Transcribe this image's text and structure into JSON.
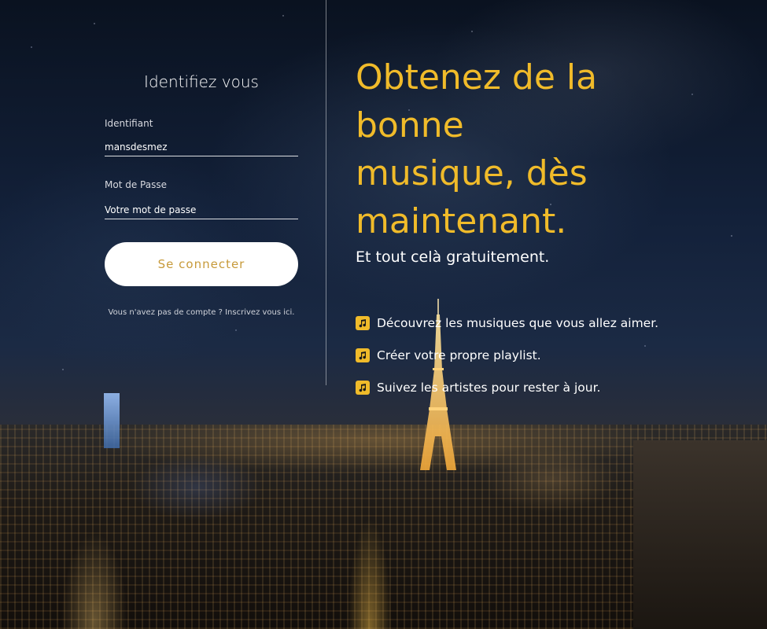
{
  "login": {
    "title": "Identifiez vous",
    "username_label": "Identifiant",
    "username_value": "mansdesmez",
    "password_label": "Mot de Passe",
    "password_placeholder": "Votre mot de passe",
    "submit_label": "Se connecter",
    "signup_text": "Vous n'avez pas de compte ? Inscrivez vous ici."
  },
  "promo": {
    "headline_lines": [
      "Obtenez de la bonne",
      "musique, dès",
      "maintenant."
    ],
    "subline": "Et tout celà gratuitement.",
    "features": [
      {
        "icon": "music-note-icon",
        "text": "Découvrez les musiques que vous allez aimer."
      },
      {
        "icon": "music-note-icon",
        "text": "Créer votre propre playlist."
      },
      {
        "icon": "music-note-icon",
        "text": "Suivez les artistes pour rester à jour."
      }
    ]
  },
  "colors": {
    "accent": "#f0bb2a",
    "button_text": "#c79a3a",
    "text": "#ffffff"
  },
  "background": "night-city-eiffel-tower-photo"
}
